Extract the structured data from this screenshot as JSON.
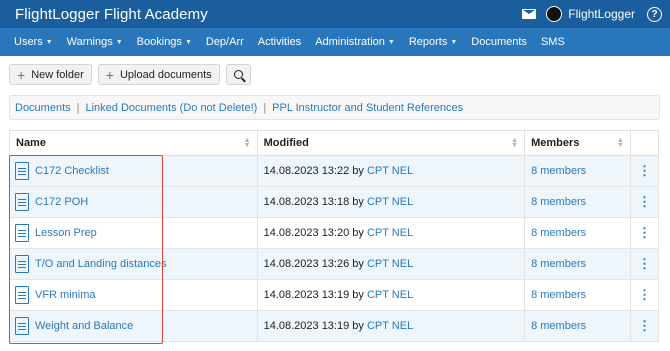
{
  "app": {
    "title": "FlightLogger Flight Academy",
    "user": "FlightLogger"
  },
  "nav": [
    {
      "label": "Users",
      "dropdown": true
    },
    {
      "label": "Warnings",
      "dropdown": true
    },
    {
      "label": "Bookings",
      "dropdown": true
    },
    {
      "label": "Dep/Arr",
      "dropdown": false
    },
    {
      "label": "Activities",
      "dropdown": false
    },
    {
      "label": "Administration",
      "dropdown": true
    },
    {
      "label": "Reports",
      "dropdown": true
    },
    {
      "label": "Documents",
      "dropdown": false
    },
    {
      "label": "SMS",
      "dropdown": false
    }
  ],
  "toolbar": {
    "new_folder": "New folder",
    "upload": "Upload documents"
  },
  "breadcrumb": [
    "Documents",
    "Linked Documents (Do not Delete!)",
    "PPL Instructor and Student References"
  ],
  "table": {
    "headers": {
      "name": "Name",
      "modified": "Modified",
      "members": "Members"
    },
    "rows": [
      {
        "name": "C172 Checklist",
        "date": "14.08.2023 13:22 by",
        "by": "CPT NEL",
        "members": "8 members"
      },
      {
        "name": "C172 POH",
        "date": "14.08.2023 13:18 by",
        "by": "CPT NEL",
        "members": "8 members"
      },
      {
        "name": "Lesson Prep",
        "date": "14.08.2023 13:20 by",
        "by": "CPT NEL",
        "members": "8 members"
      },
      {
        "name": "T/O and Landing distances",
        "date": "14.08.2023 13:26 by",
        "by": "CPT NEL",
        "members": "8 members"
      },
      {
        "name": "VFR minima",
        "date": "14.08.2023 13:19 by",
        "by": "CPT NEL",
        "members": "8 members"
      },
      {
        "name": "Weight and Balance",
        "date": "14.08.2023 13:19 by",
        "by": "CPT NEL",
        "members": "8 members"
      }
    ]
  },
  "colors": {
    "topbar": "#1b5e9e",
    "navbar": "#2a76bb",
    "link": "#2a7abf",
    "highlight": "#e0453a",
    "row_alt": "#eef5fb"
  }
}
